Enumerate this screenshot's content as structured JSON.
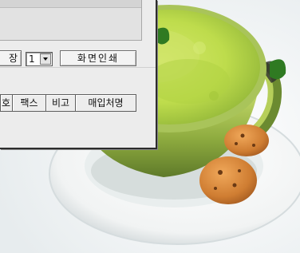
{
  "toolbar": {
    "save_label": "장",
    "page_value": "1",
    "print_label": "화면인쇄"
  },
  "grid": {
    "columns": [
      "호",
      "팩스",
      "비고",
      "매입처명"
    ]
  },
  "wallpaper": {
    "subject": "green-tea-latte-cup",
    "colors": {
      "tea_foam": "#b8d84a",
      "cup": "#a7c457",
      "saucer": "#ffffff",
      "cookie": "#d98a3c",
      "leaf": "#2f7a22",
      "background": "#f4f6f6"
    }
  }
}
